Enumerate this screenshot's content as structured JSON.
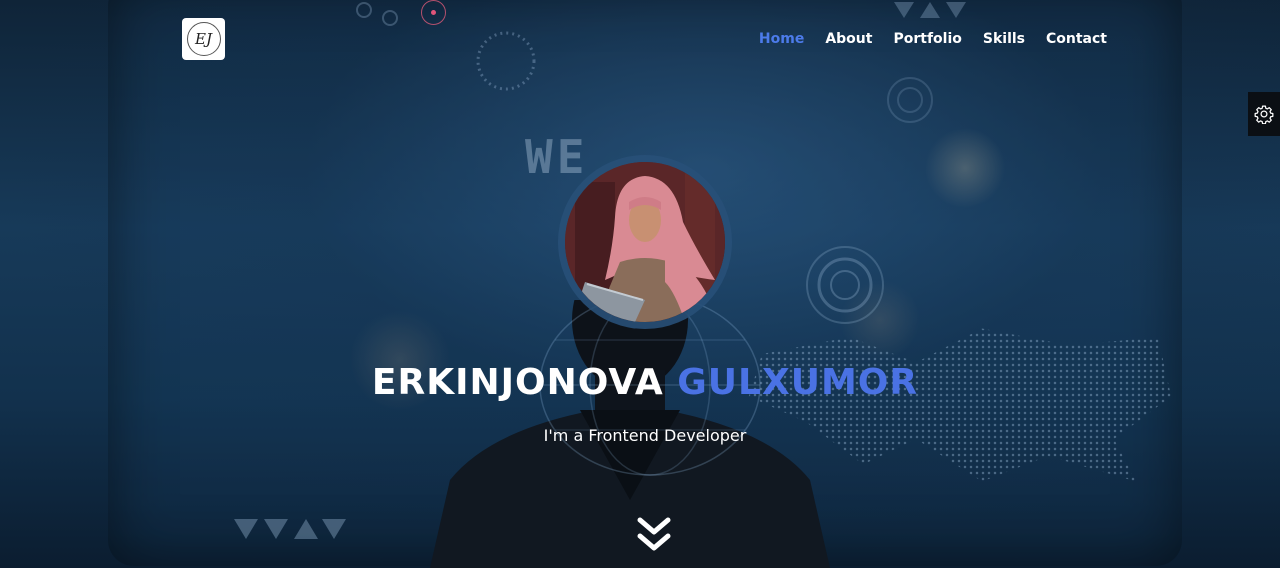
{
  "logo": {
    "text": "EJ"
  },
  "nav": {
    "items": [
      {
        "label": "Home",
        "active": true
      },
      {
        "label": "About",
        "active": false
      },
      {
        "label": "Portfolio",
        "active": false
      },
      {
        "label": "Skills",
        "active": false
      },
      {
        "label": "Contact",
        "active": false
      }
    ]
  },
  "hero": {
    "first_name": "ERKINJONOVA",
    "last_name": "GULXUMOR",
    "subtitle": "I'm a Frontend Developer"
  },
  "icons": {
    "settings": "gear-icon",
    "scroll": "double-chevron-down-icon"
  },
  "colors": {
    "accent": "#4a72e4",
    "nav_active": "#4c7bea",
    "text": "#ffffff",
    "background": "#12314d"
  }
}
